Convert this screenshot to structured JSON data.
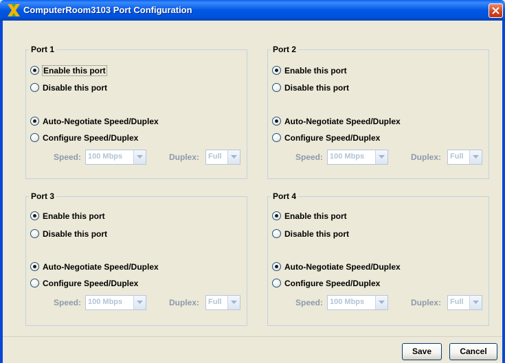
{
  "window": {
    "title": "ComputerRoom3103 Port Configuration",
    "title_icon": "app-x-icon",
    "close_icon": "close-icon"
  },
  "colors": {
    "titlebar": "#0058e6",
    "panel_border": "#c4d0e0",
    "disabled_text": "#8c9aab",
    "background": "#ece9d8"
  },
  "ports": [
    {
      "title": "Port 1",
      "enable_label": "Enable this port",
      "disable_label": "Disable this port",
      "enabled": true,
      "auto_label": "Auto-Negotiate Speed/Duplex",
      "configure_label": "Configure Speed/Duplex",
      "auto_negotiate": true,
      "speed_label": "Speed:",
      "speed_value": "100 Mbps",
      "duplex_label": "Duplex:",
      "duplex_value": "Full"
    },
    {
      "title": "Port 2",
      "enable_label": "Enable this port",
      "disable_label": "Disable this port",
      "enabled": true,
      "auto_label": "Auto-Negotiate Speed/Duplex",
      "configure_label": "Configure Speed/Duplex",
      "auto_negotiate": true,
      "speed_label": "Speed:",
      "speed_value": "100 Mbps",
      "duplex_label": "Duplex:",
      "duplex_value": "Full"
    },
    {
      "title": "Port 3",
      "enable_label": "Enable this port",
      "disable_label": "Disable this port",
      "enabled": true,
      "auto_label": "Auto-Negotiate Speed/Duplex",
      "configure_label": "Configure Speed/Duplex",
      "auto_negotiate": true,
      "speed_label": "Speed:",
      "speed_value": "100 Mbps",
      "duplex_label": "Duplex:",
      "duplex_value": "Full"
    },
    {
      "title": "Port 4",
      "enable_label": "Enable this port",
      "disable_label": "Disable this port",
      "enabled": true,
      "auto_label": "Auto-Negotiate Speed/Duplex",
      "configure_label": "Configure Speed/Duplex",
      "auto_negotiate": true,
      "speed_label": "Speed:",
      "speed_value": "100 Mbps",
      "duplex_label": "Duplex:",
      "duplex_value": "Full"
    }
  ],
  "footer": {
    "save_label": "Save",
    "cancel_label": "Cancel"
  }
}
